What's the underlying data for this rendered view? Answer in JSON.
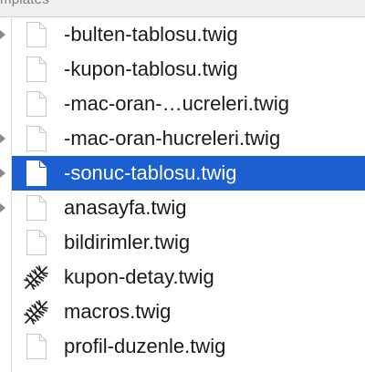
{
  "header": {
    "label": "mplates"
  },
  "files": [
    {
      "name": "-bulten-tablosu.twig",
      "icon": "document-icon",
      "selected": false
    },
    {
      "name": "-kupon-tablosu.twig",
      "icon": "document-icon",
      "selected": false
    },
    {
      "name": "-mac-oran-…ucreleri.twig",
      "icon": "document-icon",
      "selected": false
    },
    {
      "name": "-mac-oran-hucreleri.twig",
      "icon": "document-icon",
      "selected": false
    },
    {
      "name": "-sonuc-tablosu.twig",
      "icon": "document-icon",
      "selected": true
    },
    {
      "name": "anasayfa.twig",
      "icon": "document-icon",
      "selected": false
    },
    {
      "name": "bildirimler.twig",
      "icon": "document-icon",
      "selected": false
    },
    {
      "name": "kupon-detay.twig",
      "icon": "twig-branch-icon",
      "selected": false
    },
    {
      "name": "macros.twig",
      "icon": "twig-branch-icon",
      "selected": false
    },
    {
      "name": "profil-duzenle.twig",
      "icon": "document-icon",
      "selected": false
    }
  ],
  "colors": {
    "selection": "#1c5fd1",
    "text": "#1a1a1a",
    "selected_text": "#ffffff"
  }
}
